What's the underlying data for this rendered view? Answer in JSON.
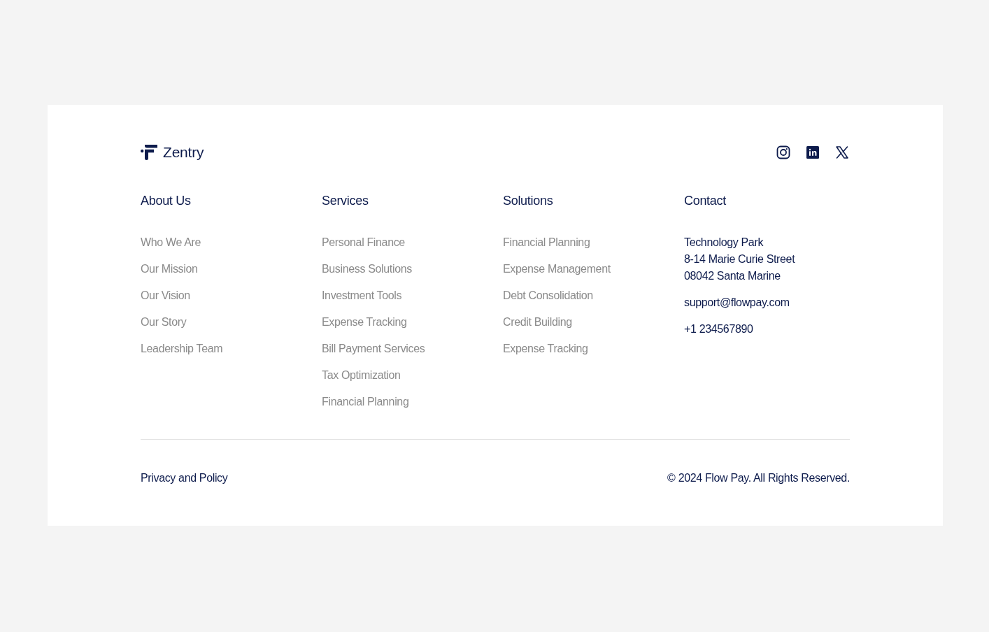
{
  "logo": {
    "name": "Zentry"
  },
  "social": [
    {
      "kind": "instagram"
    },
    {
      "kind": "linkedin"
    },
    {
      "kind": "x"
    }
  ],
  "link_columns": [
    {
      "heading": "About Us",
      "links": [
        "Who We Are",
        "Our Mission",
        "Our Vision",
        "Our Story",
        "Leadership Team"
      ]
    },
    {
      "heading": "Services",
      "links": [
        "Personal Finance",
        "Business Solutions",
        "Investment Tools",
        "Expense Tracking",
        "Bill Payment Services",
        "Tax Optimization",
        "Financial Planning"
      ]
    },
    {
      "heading": "Solutions",
      "links": [
        "Financial Planning",
        "Expense Management",
        "Debt Consolidation",
        "Credit Building",
        "Expense Tracking"
      ]
    }
  ],
  "contact": {
    "heading": "Contact",
    "address": [
      "Technology Park",
      "8-14 Marie Curie Street",
      "08042 Santa Marine"
    ],
    "email": "support@flowpay.com",
    "phone": "+1 234567890"
  },
  "bottom_bar": {
    "policy_link": "Privacy and Policy",
    "copyright": "© 2024 Flow Pay. All Rights Reserved."
  }
}
